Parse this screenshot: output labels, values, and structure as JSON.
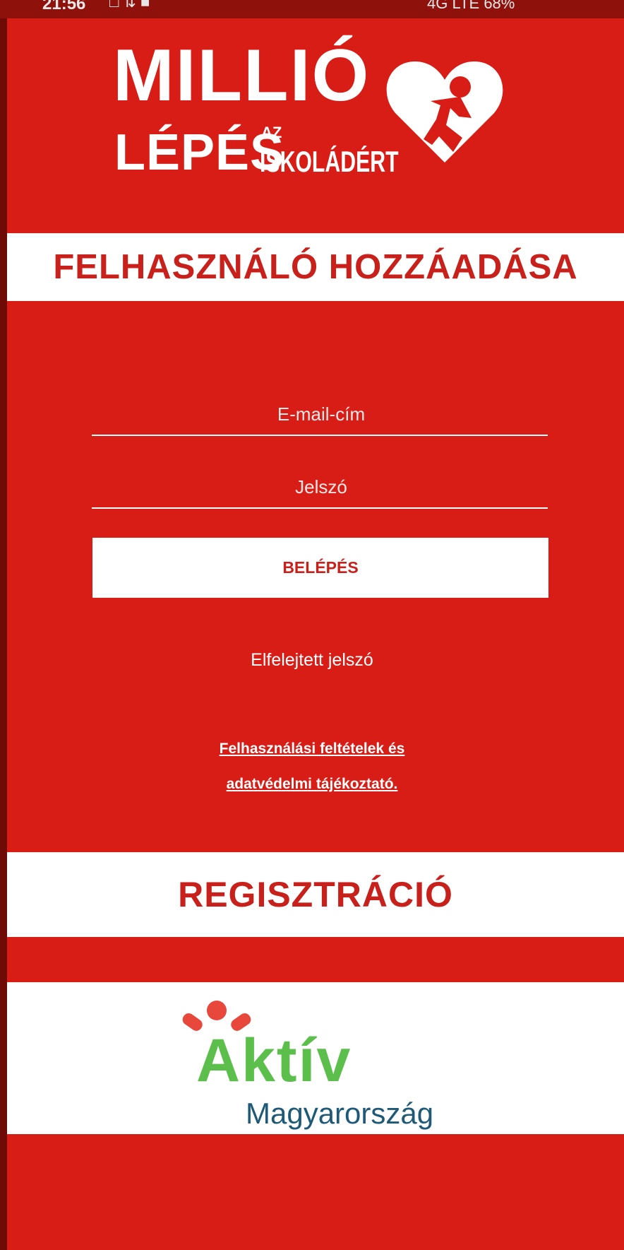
{
  "status_bar": {
    "time": "21:56",
    "network": "4G LTE",
    "battery": "68%"
  },
  "logo": {
    "line1": "MILLIÓ",
    "line2": "LÉPÉS",
    "small_top": "AZ",
    "small_bottom": "ISKOLÁDÉRT"
  },
  "header": {
    "title": "FELHASZNÁLÓ HOZZÁADÁSA"
  },
  "form": {
    "email_placeholder": "E-mail-cím",
    "password_placeholder": "Jelszó",
    "login_label": "BELÉPÉS",
    "forgot_label": "Elfelejtett jelszó",
    "terms_line1": "Felhasználási feltételek és",
    "terms_line2": "adatvédelmi tájékoztató."
  },
  "register": {
    "label": "REGISZTRÁCIÓ"
  },
  "sponsor": {
    "word": "Aktív",
    "subtitle": "Magyarország"
  },
  "colors": {
    "brand_red": "#d71d15",
    "text_red": "#c8201a",
    "green": "#5cbf4b",
    "blue": "#1e5a78"
  }
}
